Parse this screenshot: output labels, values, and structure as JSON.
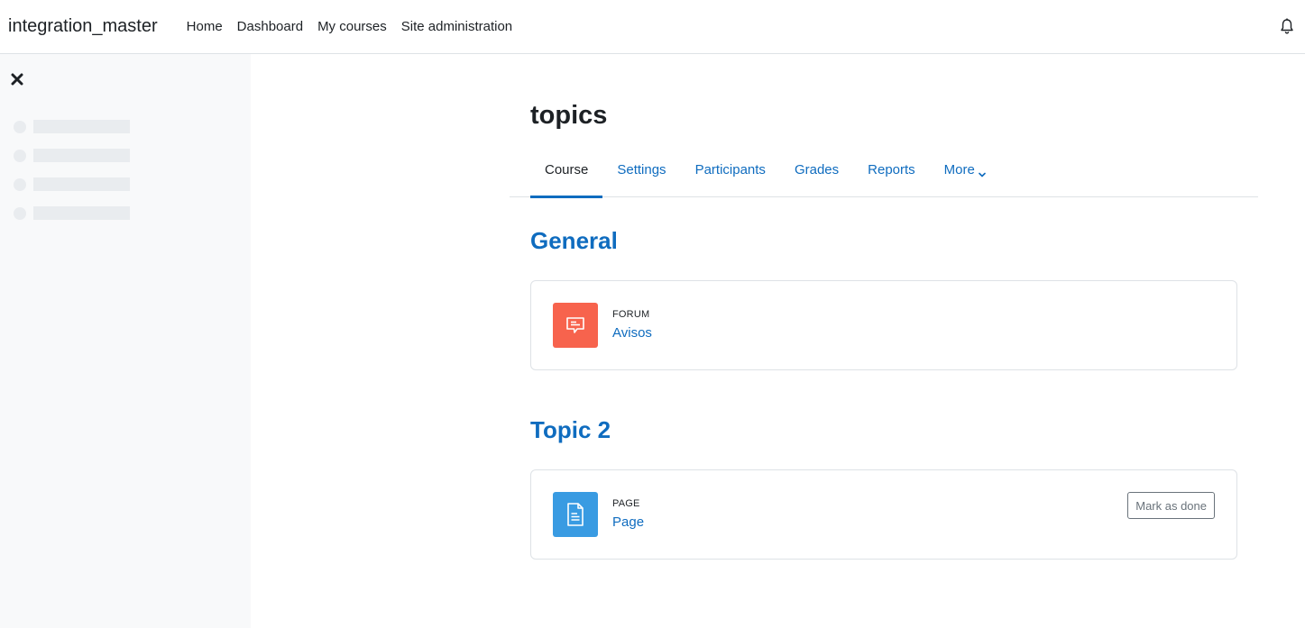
{
  "navbar": {
    "brand": "integration_master",
    "items": [
      {
        "label": "Home"
      },
      {
        "label": "Dashboard"
      },
      {
        "label": "My courses"
      },
      {
        "label": "Site administration"
      }
    ],
    "notification_icon": "bell-icon"
  },
  "drawer": {
    "close_icon": "close-icon"
  },
  "course": {
    "title": "topics",
    "tabs": [
      {
        "label": "Course",
        "active": true
      },
      {
        "label": "Settings"
      },
      {
        "label": "Participants"
      },
      {
        "label": "Grades"
      },
      {
        "label": "Reports"
      },
      {
        "label": "More",
        "icon": "chevron-down-icon"
      }
    ]
  },
  "sections": [
    {
      "title": "General",
      "activities": [
        {
          "type": "Forum",
          "name": "Avisos",
          "icon": "forum-icon",
          "color": "#f7634d"
        }
      ]
    },
    {
      "title": "Topic 2",
      "activities": [
        {
          "type": "Page",
          "name": "Page",
          "icon": "page-icon",
          "color": "#399be2",
          "completion_label": "Mark as done"
        }
      ]
    }
  ],
  "colors": {
    "accent": "#0f6cbf",
    "drawer_bg": "#f8f9fa"
  }
}
